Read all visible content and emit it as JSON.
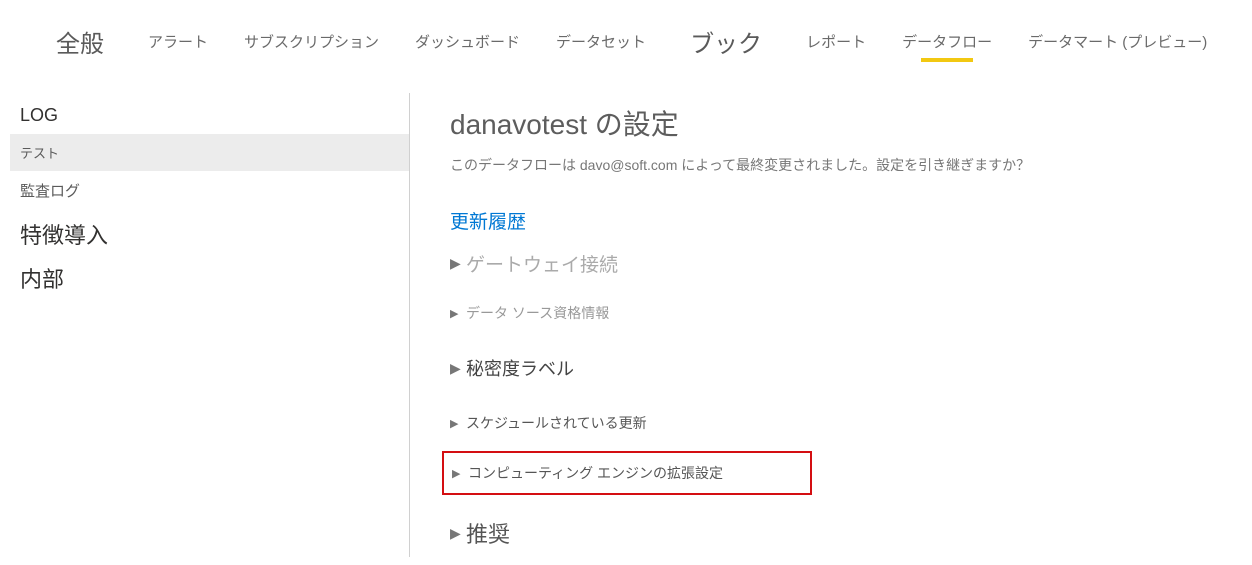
{
  "nav": {
    "general": "全般",
    "alert": "アラート",
    "subscription": "サブスクリプション",
    "dashboard": "ダッシュボード",
    "dataset": "データセット",
    "book": "ブック",
    "report": "レポート",
    "dataflow": "データフロー",
    "datamart": "データマート (プレビュー)"
  },
  "sidebar": {
    "log_header": "LOG",
    "test": "テスト",
    "audit_log": "監査ログ",
    "feature_intro": "特徴導入",
    "internal": "内部"
  },
  "main": {
    "title": "danavotest の設定",
    "subtitle": "このデータフローは davo@soft.com によって最終変更されました。設定を引き継ぎますか？",
    "update_history": "更新履歴",
    "gateway_conn": "ゲートウェイ接続",
    "datasource_creds": "データ ソース資格情報",
    "sensitivity_label": "秘密度ラベル",
    "scheduled_refresh": "スケジュールされている更新",
    "compute_engine": "コンピューティング エンジンの拡張設定",
    "recommend": "推奨"
  }
}
